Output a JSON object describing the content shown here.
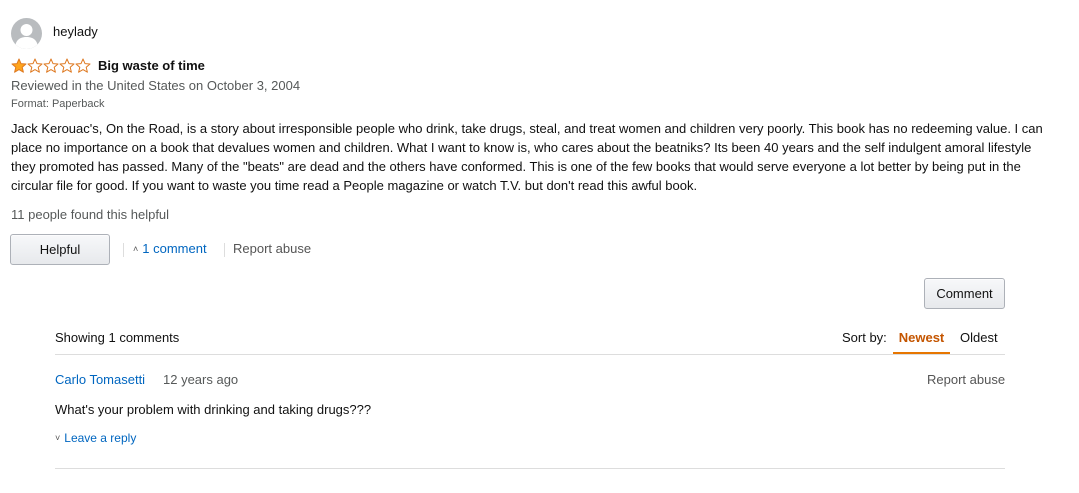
{
  "review": {
    "username": "heylady",
    "rating": 1,
    "max_rating": 5,
    "title": "Big waste of time",
    "meta": "Reviewed in the United States on October 3, 2004",
    "format": "Format: Paperback",
    "body": "Jack Kerouac's, On the Road, is a story about irresponsible people who drink, take drugs, steal, and treat women and children very poorly. This book has no redeeming value. I can place no importance on a book that devalues women and children. What I want to know is, who cares about the beatniks? Its been 40 years and the self indulgent amoral lifestyle they promoted has passed. Many of the \"beats\" are dead and the others have conformed. This is one of the few books that would serve everyone a lot better by being put in the circular file for good. If you want to waste you time read a People magazine or watch T.V. but don't read this awful book.",
    "helpful_count": "11 people found this helpful",
    "helpful_button": "Helpful",
    "comment_link": "1 comment",
    "report_abuse": "Report abuse"
  },
  "colors": {
    "star_filled": "#ffa41c",
    "star_outline": "#de7921",
    "link": "#0066c0",
    "sort_active": "#c45500"
  },
  "comments": {
    "comment_button": "Comment",
    "showing": "Showing 1 comments",
    "sort_label": "Sort by:",
    "sort_options": [
      "Newest",
      "Oldest"
    ],
    "sort_selected": "Newest",
    "items": [
      {
        "author": "Carlo Tomasetti",
        "time": "12 years ago",
        "report_abuse": "Report abuse",
        "text": "What's your problem with drinking and taking drugs???",
        "reply_link": "Leave a reply"
      }
    ]
  }
}
